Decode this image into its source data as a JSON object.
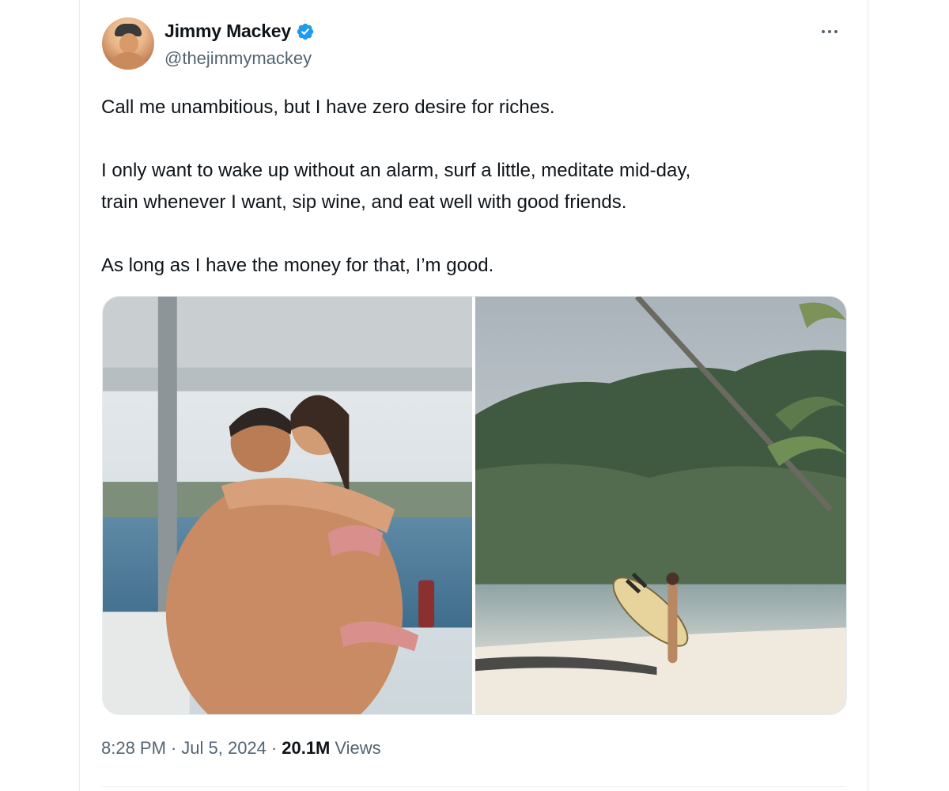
{
  "tweet": {
    "author": {
      "display_name": "Jimmy Mackey",
      "handle": "@thejimmymackey",
      "verified": true,
      "avatar_icon": "profile-photo"
    },
    "more_icon": "more-horizontal-icon",
    "paragraphs": [
      "Call me unambitious, but I have zero desire for riches.",
      "I only want to wake up without an alarm, surf a little, meditate mid-day,",
      "train whenever I want, sip wine, and eat well with good friends.",
      "As long as I have the money for that, I’m good."
    ],
    "media": [
      {
        "icon": "photo-couple-on-boat"
      },
      {
        "icon": "photo-surfer-on-beach"
      }
    ],
    "meta": {
      "time": "8:28 PM",
      "separator": "·",
      "date": "Jul 5, 2024",
      "views_count": "20.1M",
      "views_label": "Views"
    }
  },
  "colors": {
    "text_primary": "#0f1419",
    "text_secondary": "#536471",
    "verified_blue": "#1d9bf0",
    "border": "#e6ecf0"
  }
}
